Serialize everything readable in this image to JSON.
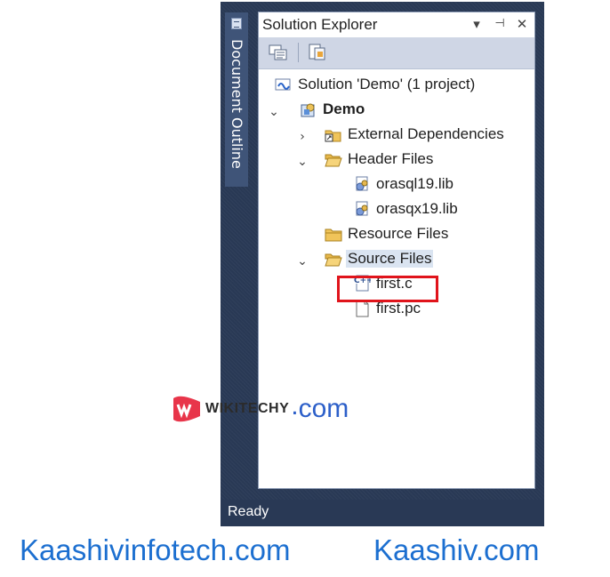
{
  "side_panel": {
    "tab_label": "Document Outline"
  },
  "solution_explorer": {
    "title": "Solution Explorer",
    "title_buttons": [
      "▾",
      "⊣",
      "✕"
    ],
    "tree": [
      {
        "label": "Solution 'Demo' (1 project)",
        "icon": "solution-icon",
        "expander": "",
        "bold": false
      },
      {
        "label": "Demo",
        "icon": "project-icon",
        "expander": "expanded",
        "bold": true
      },
      {
        "label": "External Dependencies",
        "icon": "external-deps-folder-icon",
        "expander": "collapsed",
        "bold": false
      },
      {
        "label": "Header Files",
        "icon": "open-folder-icon",
        "expander": "expanded",
        "bold": false
      },
      {
        "label": "orasql19.lib",
        "icon": "lib-file-icon",
        "expander": "",
        "bold": false
      },
      {
        "label": "orasqx19.lib",
        "icon": "lib-file-icon",
        "expander": "",
        "bold": false
      },
      {
        "label": "Resource Files",
        "icon": "folder-icon",
        "expander": "",
        "bold": false
      },
      {
        "label": "Source Files",
        "icon": "open-folder-icon",
        "expander": "expanded",
        "bold": false,
        "selected": true
      },
      {
        "label": "first.c",
        "icon": "cpp-file-icon",
        "expander": "",
        "bold": false,
        "highlighted": true
      },
      {
        "label": "first.pc",
        "icon": "blank-file-icon",
        "expander": "",
        "bold": false
      }
    ]
  },
  "status_bar": {
    "text": "Ready"
  },
  "watermark": {
    "brand": "WIKITECHY",
    "dot": ".",
    "com": "com"
  },
  "footer": {
    "left": "Kaashivinfotech.com",
    "right": "Kaashiv.com"
  },
  "colors": {
    "frame": "#293955",
    "toolbar": "#cfd6e5",
    "highlight": "#e0141b",
    "link": "#1c6fd0"
  }
}
